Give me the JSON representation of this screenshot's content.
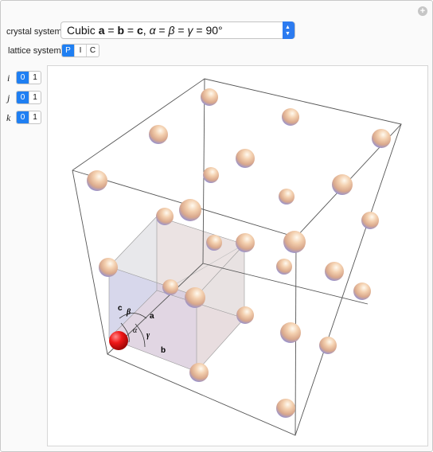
{
  "controls": {
    "crystal_system_label": "crystal system",
    "crystal_system_value": "Cubic a = b = c, α = β = γ = 90°",
    "lattice_system_label": "lattice system",
    "lattice_options": [
      "P",
      "I",
      "C"
    ],
    "lattice_selected": "P",
    "i_label": "i",
    "j_label": "j",
    "k_label": "k",
    "index_options": [
      "0",
      "1"
    ],
    "index_selected": "0"
  },
  "diagram": {
    "edge_labels": {
      "a": "a",
      "b": "b",
      "c": "c"
    },
    "angle_labels": {
      "alpha": "α",
      "beta": "β",
      "gamma": "γ"
    },
    "colors": {
      "atom_highlight": "#ff1a1a",
      "atom_body": "#f0c8a8",
      "atom_shade": "#8c8fd8",
      "face_pink": "#e6c4c4",
      "face_lavender": "#c9c9e6",
      "face_grey": "#e4e4e4"
    }
  }
}
